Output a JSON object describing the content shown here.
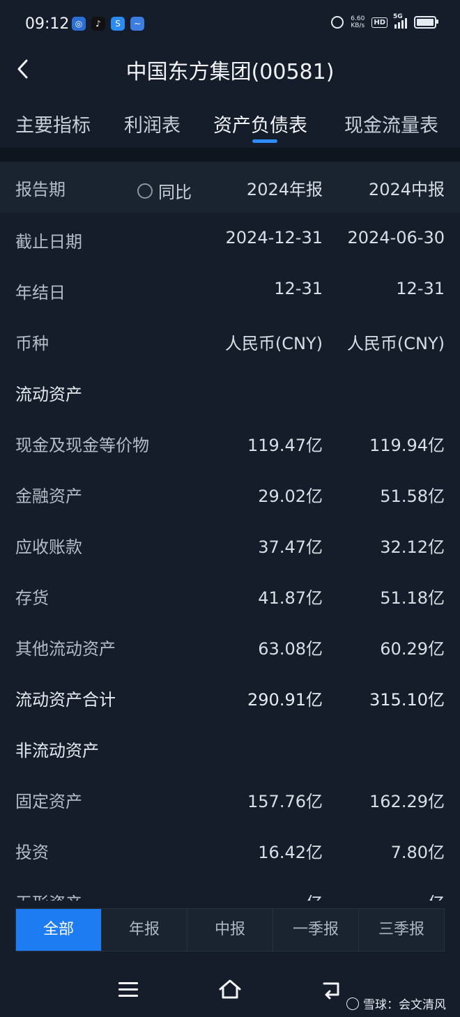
{
  "status_bar": {
    "time": "09:12",
    "net_speed_value": "6.60",
    "net_speed_unit": "KB/s",
    "hd": "HD",
    "network": "5G"
  },
  "header": {
    "title": "中国东方集团(00581)"
  },
  "tabs": [
    {
      "label": "主要指标"
    },
    {
      "label": "利润表"
    },
    {
      "label": "资产负债表",
      "active": true
    },
    {
      "label": "现金流量表"
    }
  ],
  "table": {
    "header": {
      "label": "报告期",
      "yoy_label": "同比",
      "col1": "2024年报",
      "col2": "2024中报"
    },
    "rows": [
      {
        "label": "截止日期",
        "v1": "2024-12-31",
        "v2": "2024-06-30"
      },
      {
        "label": "年结日",
        "v1": "12-31",
        "v2": "12-31"
      },
      {
        "label": "币种",
        "v1": "人民币(CNY)",
        "v2": "人民币(CNY)"
      },
      {
        "label": "流动资产",
        "v1": "",
        "v2": ""
      },
      {
        "label": "现金及现金等价物",
        "v1": "119.47亿",
        "v2": "119.94亿"
      },
      {
        "label": "金融资产",
        "v1": "29.02亿",
        "v2": "51.58亿"
      },
      {
        "label": "应收账款",
        "v1": "37.47亿",
        "v2": "32.12亿"
      },
      {
        "label": "存货",
        "v1": "41.87亿",
        "v2": "51.18亿"
      },
      {
        "label": "其他流动资产",
        "v1": "63.08亿",
        "v2": "60.29亿"
      },
      {
        "label": "流动资产合计",
        "v1": "290.91亿",
        "v2": "315.10亿"
      },
      {
        "label": "非流动资产",
        "v1": "",
        "v2": ""
      },
      {
        "label": "固定资产",
        "v1": "157.76亿",
        "v2": "162.29亿"
      },
      {
        "label": "投资",
        "v1": "16.42亿",
        "v2": "7.80亿"
      },
      {
        "label": "无形资产",
        "v1": "亿",
        "v2": "亿"
      }
    ]
  },
  "filters": [
    {
      "label": "全部",
      "active": true
    },
    {
      "label": "年报"
    },
    {
      "label": "中报"
    },
    {
      "label": "一季报"
    },
    {
      "label": "三季报"
    }
  ],
  "watermark": {
    "text": "雪球：会文清风"
  },
  "colors": {
    "accent": "#1e7cf2",
    "background": "#141d29"
  }
}
